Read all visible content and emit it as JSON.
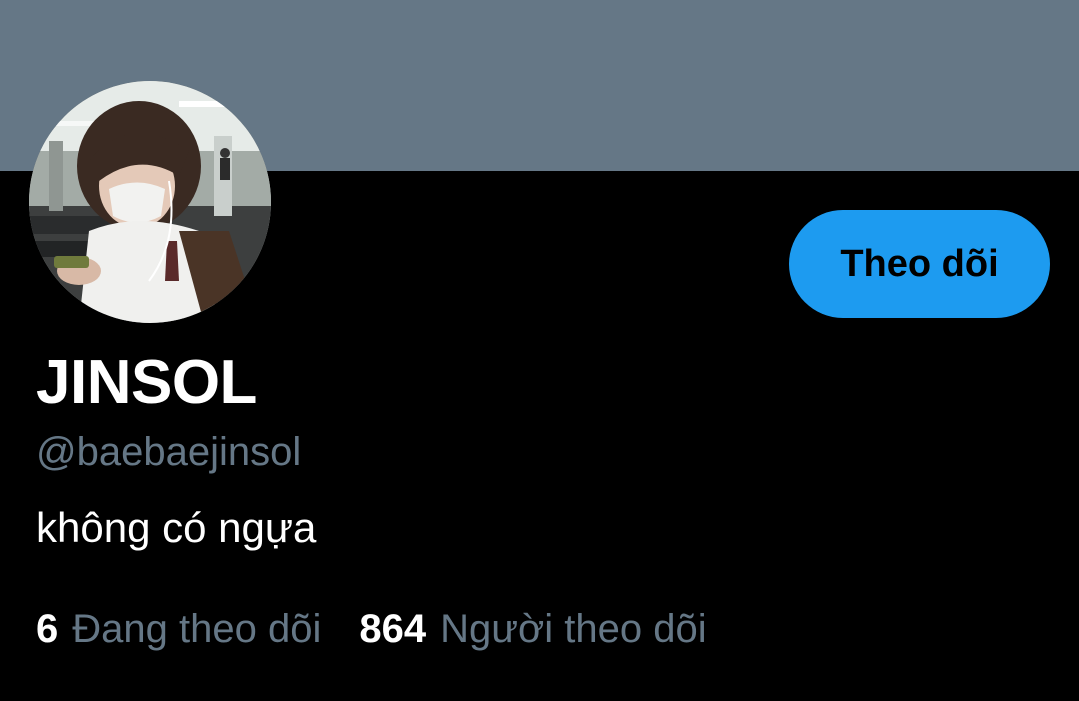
{
  "colors": {
    "banner": "#657786",
    "background": "#000000",
    "accent": "#1d9bf0",
    "muted_text": "#657786",
    "primary_text": "#ffffff"
  },
  "profile": {
    "avatar_icon": "profile-photo",
    "follow_button_label": "Theo dõi",
    "display_name": "JINSOL",
    "handle": "@baebaejinsol",
    "bio": "không có ngựa"
  },
  "stats": {
    "following_count": "6",
    "following_label": "Đang theo dõi",
    "followers_count": "864",
    "followers_label": "Người theo dõi"
  }
}
